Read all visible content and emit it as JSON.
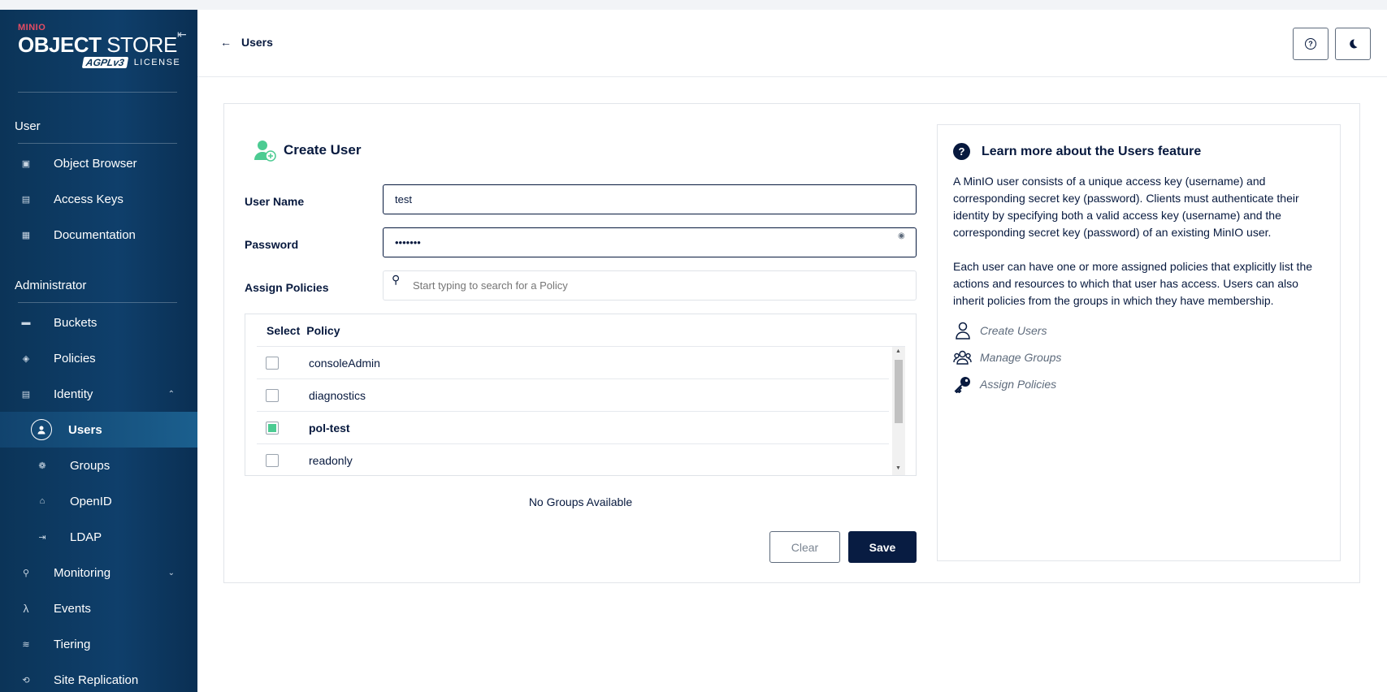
{
  "sidebar": {
    "brand_small": "MINIO",
    "brand_main_bold": "OBJECT",
    "brand_main_thin": " STORE",
    "agpl": "AGPLv3",
    "license": "LICENSE",
    "sections": {
      "user": "User",
      "administrator": "Administrator"
    },
    "items": {
      "object_browser": "Object Browser",
      "access_keys": "Access Keys",
      "documentation": "Documentation",
      "buckets": "Buckets",
      "policies": "Policies",
      "identity": "Identity",
      "users": "Users",
      "groups": "Groups",
      "openid": "OpenID",
      "ldap": "LDAP",
      "monitoring": "Monitoring",
      "events": "Events",
      "tiering": "Tiering",
      "site_replication": "Site Replication"
    }
  },
  "header": {
    "back_label": "Users"
  },
  "form": {
    "title": "Create User",
    "username_label": "User Name",
    "username_value": "test",
    "password_label": "Password",
    "password_value": "•••••••",
    "assign_label": "Assign Policies",
    "search_placeholder": "Start typing to search for a Policy",
    "col_select": "Select",
    "col_policy": "Policy",
    "policies": [
      {
        "name": "consoleAdmin",
        "checked": false
      },
      {
        "name": "diagnostics",
        "checked": false
      },
      {
        "name": "pol-test",
        "checked": true
      },
      {
        "name": "readonly",
        "checked": false
      }
    ],
    "no_groups": "No Groups Available",
    "clear_label": "Clear",
    "save_label": "Save"
  },
  "help": {
    "title": "Learn more about the Users feature",
    "p1": "A MinIO user consists of a unique access key (username) and corresponding secret key (password). Clients must authenticate their identity by specifying both a valid access key (username) and the corresponding secret key (password) of an existing MinIO user.",
    "p2": "Each user can have one or more assigned policies that explicitly list the actions and resources to which that user has access. Users can also inherit policies from the groups in which they have membership.",
    "links": {
      "create_users": "Create Users",
      "manage_groups": "Manage Groups",
      "assign_policies": "Assign Policies"
    }
  },
  "colors": {
    "sidebar": "#0f3f6b",
    "accent_green": "#4ccb92",
    "primary_button": "#081c42"
  }
}
